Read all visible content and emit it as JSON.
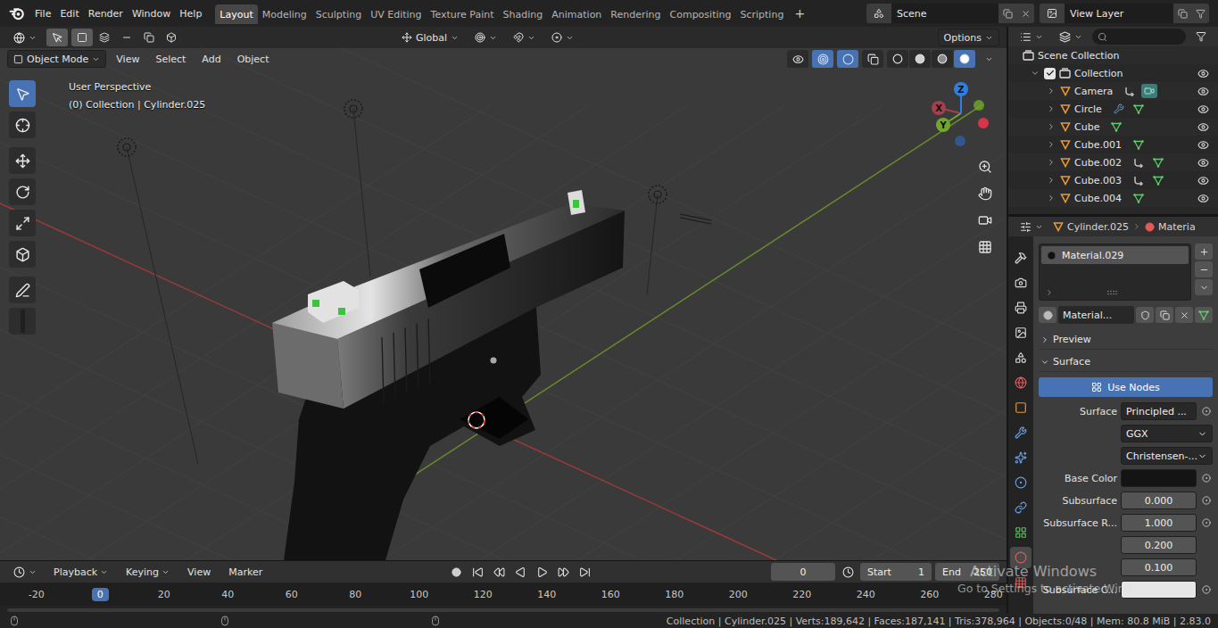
{
  "top_bar": {
    "menus": [
      "File",
      "Edit",
      "Render",
      "Window",
      "Help"
    ],
    "workspaces": [
      {
        "label": "Layout",
        "selected": true
      },
      {
        "label": "Modeling",
        "selected": false
      },
      {
        "label": "Sculpting",
        "selected": false
      },
      {
        "label": "UV Editing",
        "selected": false
      },
      {
        "label": "Texture Paint",
        "selected": false
      },
      {
        "label": "Shading",
        "selected": false
      },
      {
        "label": "Animation",
        "selected": false
      },
      {
        "label": "Rendering",
        "selected": false
      },
      {
        "label": "Compositing",
        "selected": false
      },
      {
        "label": "Scripting",
        "selected": false
      }
    ],
    "add_workspace": "+",
    "scene": "Scene",
    "view_layer": "View Layer"
  },
  "viewport": {
    "orientation": "Global",
    "options": "Options",
    "mode": "Object Mode",
    "menus": [
      "View",
      "Select",
      "Add",
      "Object"
    ],
    "select_modes": [
      {
        "kind": "new",
        "selected": true
      },
      {
        "kind": "extend",
        "selected": false
      },
      {
        "kind": "subtract",
        "selected": false
      },
      {
        "kind": "invert",
        "selected": false
      },
      {
        "kind": "intersect",
        "selected": false
      }
    ],
    "tools": [
      {
        "kind": "select",
        "selected": true
      },
      {
        "kind": "cursor",
        "selected": false
      },
      {
        "kind": "move",
        "selected": false
      },
      {
        "kind": "rotate",
        "selected": false
      },
      {
        "kind": "scale",
        "selected": false
      },
      {
        "kind": "transform",
        "selected": false
      },
      {
        "kind": "annotate",
        "selected": false
      },
      {
        "kind": "measure",
        "selected": false
      }
    ],
    "toggles": [
      {
        "kind": "visibility",
        "on": false
      },
      {
        "kind": "gizmo",
        "on": true
      },
      {
        "kind": "overlay",
        "on": true
      },
      {
        "kind": "xray",
        "on": false
      }
    ],
    "shading": [
      {
        "kind": "wireframe",
        "selected": false
      },
      {
        "kind": "solid",
        "selected": false
      },
      {
        "kind": "material",
        "selected": false
      },
      {
        "kind": "rendered",
        "selected": true
      }
    ],
    "view_name": "User Perspective",
    "context": "(0) Collection | Cylinder.025",
    "axes": [
      {
        "label": "X",
        "color": "#a2404c"
      },
      {
        "label": "Y",
        "color": "#6fa82c"
      },
      {
        "label": "Z",
        "color": "#2f7fe0"
      }
    ]
  },
  "timeline": {
    "menus": [
      {
        "label": "Playback",
        "dropdown": true
      },
      {
        "label": "Keying",
        "dropdown": true
      },
      {
        "label": "View",
        "dropdown": false
      },
      {
        "label": "Marker",
        "dropdown": false
      }
    ],
    "current_frame": "0",
    "start_label": "Start",
    "start": "1",
    "end_label": "End",
    "end": "250",
    "ruler": [
      {
        "label": "-20",
        "selected": false
      },
      {
        "label": "0",
        "selected": true
      },
      {
        "label": "20",
        "selected": false
      },
      {
        "label": "40",
        "selected": false
      },
      {
        "label": "60",
        "selected": false
      },
      {
        "label": "80",
        "selected": false
      },
      {
        "label": "100",
        "selected": false
      },
      {
        "label": "120",
        "selected": false
      },
      {
        "label": "140",
        "selected": false
      },
      {
        "label": "160",
        "selected": false
      },
      {
        "label": "180",
        "selected": false
      },
      {
        "label": "200",
        "selected": false
      },
      {
        "label": "220",
        "selected": false
      },
      {
        "label": "240",
        "selected": false
      },
      {
        "label": "260",
        "selected": false
      },
      {
        "label": "280",
        "selected": false
      }
    ]
  },
  "outliner": {
    "root": {
      "label": "Scene Collection",
      "kind": "scene",
      "children": [
        {
          "label": "Collection",
          "kind": "collection",
          "expanded": true,
          "checked": true,
          "visible": true,
          "children": [
            {
              "label": "Camera",
              "kind": "camera",
              "expanded": false,
              "visible": true
            },
            {
              "label": "Circle",
              "kind": "modified",
              "expanded": false,
              "visible": true
            },
            {
              "label": "Cube",
              "kind": "mesh",
              "expanded": false,
              "visible": true
            },
            {
              "label": "Cube.001",
              "kind": "mesh",
              "expanded": false,
              "visible": true
            },
            {
              "label": "Cube.002",
              "kind": "linked",
              "expanded": false,
              "visible": true
            },
            {
              "label": "Cube.003",
              "kind": "linked",
              "expanded": false,
              "visible": true
            },
            {
              "label": "Cube.004",
              "kind": "mesh",
              "expanded": false,
              "visible": true
            }
          ]
        }
      ]
    }
  },
  "properties": {
    "object": "Cylinder.025",
    "context": "Materia",
    "tabs": [
      {
        "kind": "tool",
        "selected": false
      },
      {
        "kind": "render",
        "selected": false
      },
      {
        "kind": "output",
        "selected": false
      },
      {
        "kind": "view_layer",
        "selected": false
      },
      {
        "kind": "scene",
        "selected": false
      },
      {
        "kind": "world",
        "selected": false
      },
      {
        "kind": "object",
        "selected": false
      },
      {
        "kind": "modifier",
        "selected": false
      },
      {
        "kind": "particles",
        "selected": false
      },
      {
        "kind": "physics",
        "selected": false
      },
      {
        "kind": "constraints",
        "selected": false
      },
      {
        "kind": "data",
        "selected": false
      },
      {
        "kind": "material",
        "selected": true
      },
      {
        "kind": "texture",
        "selected": false
      }
    ],
    "slots": [
      {
        "label": "Material.029",
        "selected": true
      }
    ],
    "material": "Material...",
    "panels": [
      {
        "label": "Preview",
        "expanded": false
      },
      {
        "label": "Surface",
        "expanded": true
      }
    ],
    "use_nodes": {
      "label": "Use Nodes",
      "on": true
    },
    "fields": [
      {
        "label": "Surface",
        "kind": "node",
        "value": "Principled ..."
      },
      {
        "kind": "dropdown",
        "value": "GGX"
      },
      {
        "kind": "dropdown",
        "value": "Christensen-..."
      },
      {
        "label": "Base Color",
        "kind": "color",
        "color": "#141414"
      },
      {
        "label": "Subsurface",
        "kind": "number",
        "value": "0.000"
      },
      {
        "label": "Subsurface R...",
        "kind": "vector",
        "values": [
          "1.000",
          "0.200",
          "0.100"
        ]
      },
      {
        "label": "Subsurface C...",
        "kind": "color",
        "color": "#e6e6e6"
      }
    ]
  },
  "watermark": {
    "title": "Activate Windows",
    "subtitle": "Go to Settings to activate Wind"
  },
  "status_bar": {
    "stats": "Collection | Cylinder.025 | Verts:189,642 | Faces:187,141 | Tris:378,964 | Objects:0/48 | Mem: 80.8 MiB | 2.83.0"
  }
}
